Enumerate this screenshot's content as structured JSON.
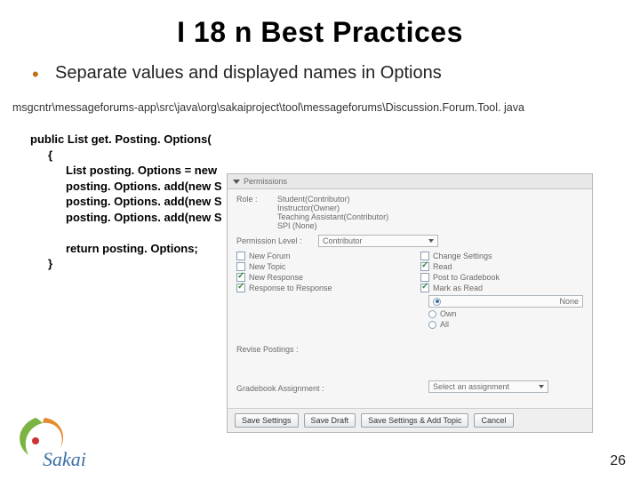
{
  "slide": {
    "title": "I 18 n Best Practices",
    "bullet": "Separate values and displayed names in Options",
    "filepath": "msgcntr\\messageforums-app\\src\\java\\org\\sakaiproject\\tool\\messageforums\\Discussion.Forum.Tool. java",
    "page_number": "26"
  },
  "code": {
    "l1": "public List get. Posting. Options(",
    "l2": "{",
    "l3": "List posting. Options = new",
    "l4": "posting. Options. add(new S",
    "l5": "posting. Options. add(new S",
    "l6": "posting. Options. add(new S",
    "l7": "return posting. Options;",
    "l8": "}"
  },
  "panel": {
    "header": "Permissions",
    "role_label": "Role :",
    "role_options": [
      "Student(Contributor)",
      "Instructor(Owner)",
      "Teaching Assistant(Contributor)",
      "SPI (None)"
    ],
    "perm_level_label": "Permission Level :",
    "perm_level_value": "Contributor",
    "checks_left": [
      "New Forum",
      "New Topic",
      "New Response",
      "Response to Response"
    ],
    "checks_right": [
      "Change Settings",
      "Read",
      "Post to Gradebook",
      "Mark as Read"
    ],
    "checks_left_state": [
      false,
      false,
      true,
      true
    ],
    "checks_right_state": [
      false,
      true,
      false,
      true
    ],
    "revise_label": "Revise Postings :",
    "radios": [
      "None",
      "Own",
      "All"
    ],
    "gradebook_label": "Gradebook Assignment :",
    "gradebook_sel": "Select an assignment",
    "buttons": [
      "Save Settings",
      "Save Draft",
      "Save Settings & Add Topic",
      "Cancel"
    ]
  },
  "logo": {
    "text": "Sakai"
  }
}
